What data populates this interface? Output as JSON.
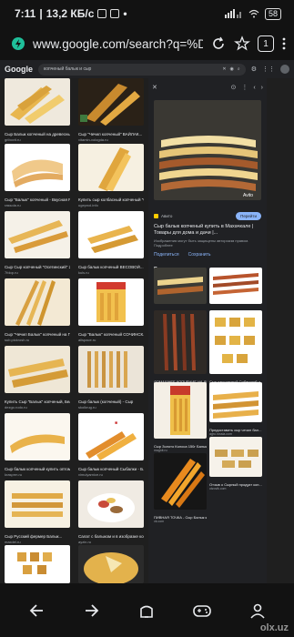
{
  "status_bar": {
    "time": "7:11",
    "speed": "13,2 КБ/с",
    "battery": "58"
  },
  "browser": {
    "url": "www.google.com/search?q=%D0%BA%",
    "tab_count": "1"
  },
  "google": {
    "logo": "Google",
    "query": "копченый балык и сыр"
  },
  "results": [
    {
      "caption": "Сыр Балык копченый на древесных о...",
      "source": "gribovit.ru"
    },
    {
      "caption": "Сыр \"Чечил копченый\" ВАЙЛАК...",
      "source": "vitamin-vologda.ru"
    },
    {
      "caption": "Сыр \"Балык\" копченый - Вкусная Раска",
      "source": "rassola.ru"
    },
    {
      "caption": "Купить сыр колбасный копченый \"Сибе...",
      "source": "ugepnol.info"
    },
    {
      "caption": "Сыр Сыр копченый \"Осетинский\" 250гр...",
      "source": "7fdop.ru"
    },
    {
      "caption": "Сыр балык копченый ВЕСОВОЙ...",
      "source": "kuls.ru"
    },
    {
      "caption": "Сыр \"Чечил Балык\" копченый на Пукаля...",
      "source": "sub.pickrosh.ru"
    },
    {
      "caption": "Сыр \"Балык\" копченый СОЧИНСК...",
      "source": "allspace.ru"
    },
    {
      "caption": "Купить Сыр \"Балык\" копченый, Бел...",
      "source": "dezgo.rodo.ru"
    },
    {
      "caption": "Сыр балык (копченый) - Сыр",
      "source": "skolkrug.ru"
    },
    {
      "caption": "Сыр балык копченый купить оптом",
      "source": "krasprm.ru"
    },
    {
      "caption": "Сыр балык копченый Сыбалки - Б...",
      "source": "vimulyarnice.ru"
    },
    {
      "caption": "Сыр Русский фермер Балык...",
      "source": "maxdel.ru"
    },
    {
      "caption": "Салат с балыком и в изобразке копченых ко...",
      "source": "ayzin.ru"
    },
    {
      "caption": "",
      "source": ""
    },
    {
      "caption": "",
      "source": ""
    }
  ],
  "panel": {
    "site_name": "Авито",
    "visit_label": "Перейти",
    "title": "Сыр балык копченый купить в Махачкале | Товары для дома и дачи |...",
    "note": "Изображения могут быть защищены авторским правом. Подробнее",
    "actions": [
      "Поделиться",
      "Сохранить"
    ],
    "related_title": "Похожие картинки",
    "watermark_badge": "Avito",
    "related": [
      {
        "caption": "",
        "source": ""
      },
      {
        "caption": "",
        "source": ""
      },
      {
        "caption": "Сыр Балык копченый...",
        "source": "avito.ru"
      },
      {
        "caption": "Ответ на копченую рыбу: Заку...",
        "source": "baraponov.rdb"
      },
      {
        "caption": "ДОМАШНЕЕ КОПЧЕНИЕ НА ДР...",
        "source": "vdka.com.ru"
      },
      {
        "caption": "Сыр рассольный Сибирский о...",
        "source": "shop.rybsh.ru"
      },
      {
        "caption": "Сыр Золото Колоса 150г Балык...",
        "source": "magnit.ru"
      },
      {
        "caption": "Предоставить сыр чечил бал...",
        "source": "agro.rossia.com"
      },
      {
        "caption": "ПИВНАЯ ТОЧКА - Сыр Балык коп...",
        "source": "vk.com"
      },
      {
        "caption": "Отзыв о Сырный продукт коп...",
        "source": "otzovik.com"
      }
    ]
  },
  "watermark": "olx.uz"
}
